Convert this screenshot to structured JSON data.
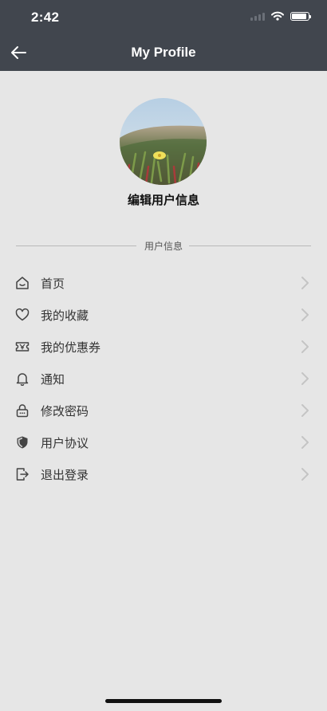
{
  "status_bar": {
    "time": "2:42"
  },
  "header": {
    "title": "My Profile"
  },
  "profile": {
    "edit_label": "编辑用户信息"
  },
  "section": {
    "label": "用户信息"
  },
  "menu": {
    "items": [
      {
        "label": "首页",
        "icon": "home-icon"
      },
      {
        "label": "我的收藏",
        "icon": "heart-icon"
      },
      {
        "label": "我的优惠券",
        "icon": "coupon-icon"
      },
      {
        "label": "通知",
        "icon": "bell-icon"
      },
      {
        "label": "修改密码",
        "icon": "lock-icon"
      },
      {
        "label": "用户协议",
        "icon": "shield-icon"
      },
      {
        "label": "退出登录",
        "icon": "logout-icon"
      }
    ]
  },
  "colors": {
    "header_bg": "#41464e",
    "page_bg": "#e6e6e6"
  }
}
